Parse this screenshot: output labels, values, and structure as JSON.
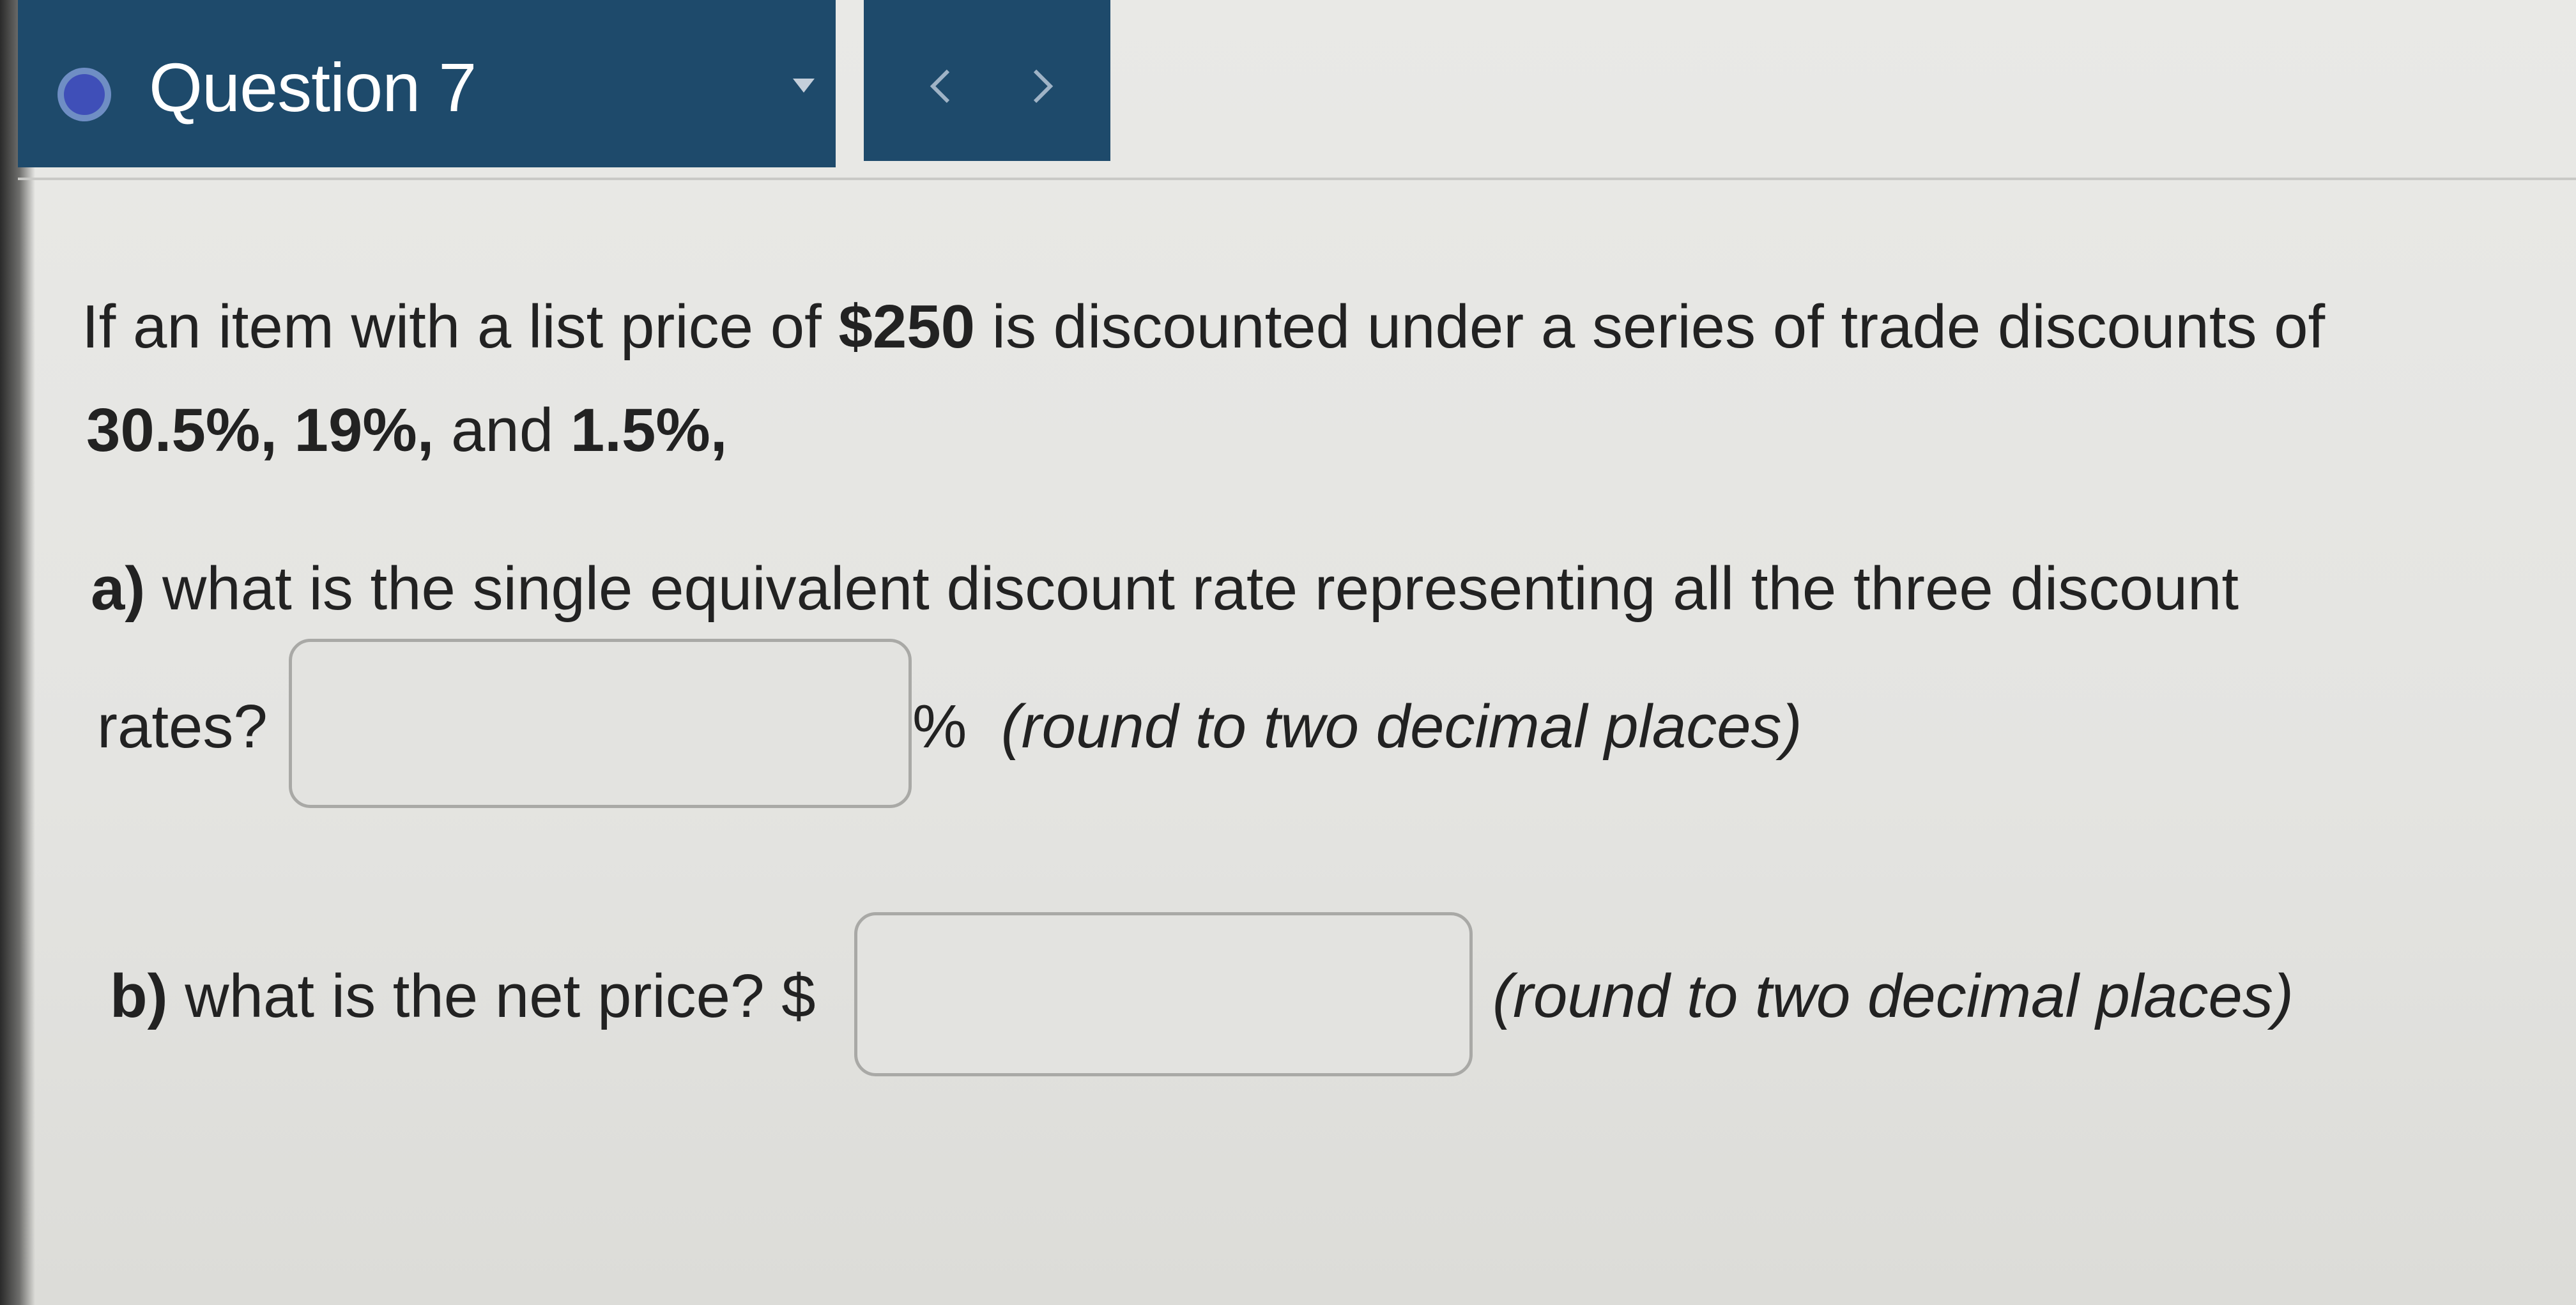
{
  "header": {
    "title": "Question 7",
    "icons": {
      "status": "question-status-dot-icon",
      "dropdown": "caret-down-icon",
      "prev": "chevron-left-icon",
      "next": "chevron-right-icon"
    }
  },
  "question": {
    "intro_1": "If an item with a list price of ",
    "list_price": "$250",
    "intro_2": " is discounted under a series of trade discounts of",
    "discount_1": "30.5%,",
    "discount_2": "19%,",
    "and_word": "and",
    "discount_3": "1.5%,",
    "part_a": {
      "label": "a)",
      "text": " what is the single equivalent discount rate representing all the three discount",
      "text_2": "rates?",
      "input_value": "",
      "unit": "%",
      "hint": "(round to two decimal places)"
    },
    "part_b": {
      "label": "b)",
      "text": " what is the net price? $",
      "input_value": "",
      "hint": "(round to two decimal places)"
    }
  },
  "colors": {
    "header_bg": "#1e4a6b",
    "page_bg": "#e6e6e3",
    "text": "#222222",
    "status_dot": "#3f4fb8"
  }
}
